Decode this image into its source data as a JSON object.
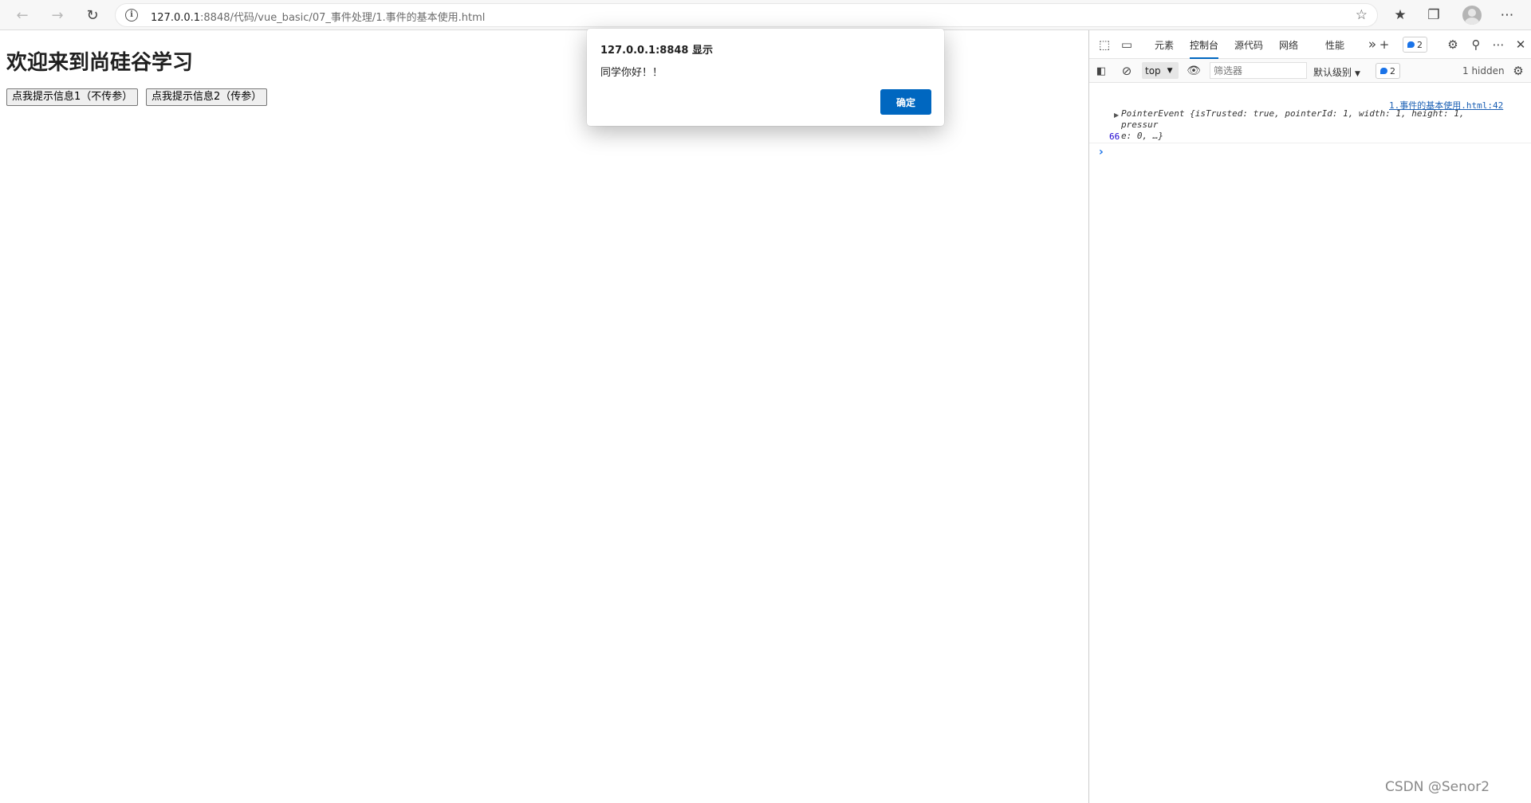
{
  "browser": {
    "url_host": "127.0.0.1",
    "url_rest": ":8848/代码/vue_basic/07_事件处理/1.事件的基本使用.html"
  },
  "page": {
    "heading": "欢迎来到尚硅谷学习",
    "button1_label": "点我提示信息1（不传参）",
    "button2_label": "点我提示信息2（传参）"
  },
  "alert": {
    "title": "127.0.0.1:8848 显示",
    "message": "同学你好！！",
    "ok_label": "确定"
  },
  "devtools": {
    "tabs": [
      "元素",
      "控制台",
      "源代码",
      "网络",
      "性能"
    ],
    "active_tab": "控制台",
    "issues_count": "2",
    "context": "top",
    "filter_placeholder": "筛选器",
    "levels_label": "默认级别",
    "messages_count": "2",
    "hidden_label": "1 hidden",
    "console_link": "1.事件的基本使用.html:42",
    "console_object_prefix": "PointerEvent",
    "console_object_line1": "{isTrusted: true, pointerId: 1, width: 1, height: 1, pressur",
    "console_object_line2": "e: 0, …}",
    "console_number": "66"
  },
  "watermark": "CSDN @Senor2",
  "colors": {
    "accent": "#0067c0",
    "badge_blue": "#1a73e8"
  }
}
